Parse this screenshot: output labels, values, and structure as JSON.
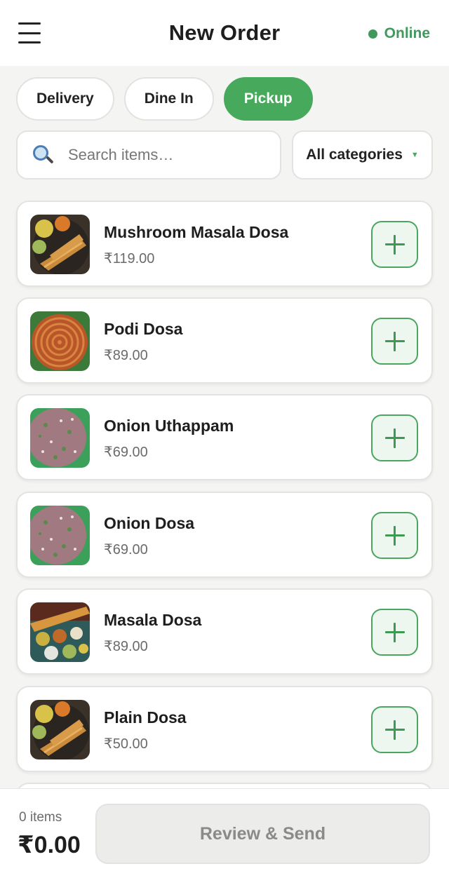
{
  "header": {
    "title": "New Order",
    "status": "Online",
    "status_color": "#3f9a5c"
  },
  "order_types": [
    {
      "label": "Delivery",
      "active": false
    },
    {
      "label": "Dine In",
      "active": false
    },
    {
      "label": "Pickup",
      "active": true
    }
  ],
  "search": {
    "placeholder": "Search items…",
    "value": ""
  },
  "category_filter": {
    "selected": "All categories"
  },
  "menu_items": [
    {
      "name": "Mushroom Masala Dosa",
      "price": "₹119.00",
      "image": "dosa-plate"
    },
    {
      "name": "Podi Dosa",
      "price": "₹89.00",
      "image": "podi-dosa"
    },
    {
      "name": "Onion Uthappam",
      "price": "₹69.00",
      "image": "uthappam"
    },
    {
      "name": "Onion Dosa",
      "price": "₹69.00",
      "image": "uthappam"
    },
    {
      "name": "Masala Dosa",
      "price": "₹89.00",
      "image": "masala-platter"
    },
    {
      "name": "Plain Dosa",
      "price": "₹50.00",
      "image": "dosa-plate"
    }
  ],
  "cart": {
    "item_count": "0 items",
    "total": "₹0.00",
    "action_label": "Review & Send"
  },
  "colors": {
    "accent": "#47a95b",
    "background": "#f4f4f2"
  }
}
